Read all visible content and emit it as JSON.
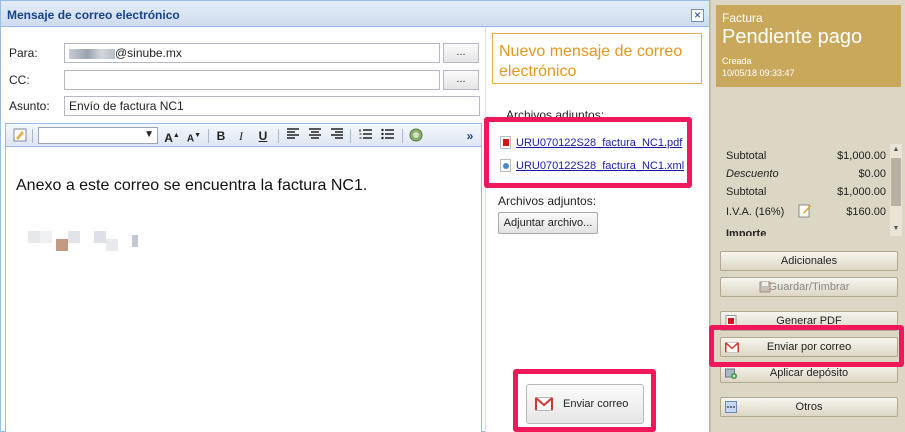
{
  "dialog": {
    "title": "Mensaje de correo electrónico",
    "close_glyph": "×"
  },
  "form": {
    "to_label": "Para:",
    "to_value": "@sinube.mx",
    "cc_label": "CC:",
    "cc_value": "",
    "subject_label": "Asunto:",
    "subject_value": "Envío de factura NC1",
    "lookup_label": "..."
  },
  "toolbar": {
    "icons": [
      "style-icon",
      "font-family-select",
      "grow-font-icon",
      "shrink-font-icon",
      "bold-icon",
      "italic-icon",
      "underline-icon",
      "align-left-icon",
      "align-center-icon",
      "align-right-icon",
      "ordered-list-icon",
      "unordered-list-icon",
      "source-edit-icon",
      "more-icon"
    ],
    "bold": "B",
    "italic": "I",
    "underline": "U",
    "more": "»"
  },
  "editor": {
    "body_text": "Anexo a este correo se encuentra la factura NC1."
  },
  "side": {
    "new_message_title": "Nuevo mensaje de correo electrónico",
    "attachments_heading": "Archivos adjuntos:",
    "attachments": [
      {
        "name": "URU070122S28_factura_NC1.pdf",
        "icon": "pdf-file-icon"
      },
      {
        "name": "URU070122S28_factura_NC1.xml",
        "icon": "xml-file-icon"
      }
    ],
    "attachments_heading_2": "Archivos adjuntos:",
    "attach_button": "Adjuntar archivo...",
    "send_button": "Enviar correo"
  },
  "invoice": {
    "type": "Factura",
    "status": "Pendiente pago",
    "created_label": "Creada",
    "created_at": "10/05/18 09:33:47",
    "status_color": "#c9a85c",
    "totals": [
      {
        "label": "Subtotal",
        "value": "$1,000.00",
        "italic": false
      },
      {
        "label": "Descuento",
        "value": "$0.00",
        "italic": true
      },
      {
        "label": "Subtotal",
        "value": "$1,000.00",
        "italic": false
      },
      {
        "label": "I.V.A. (16%)",
        "value": "$160.00",
        "italic": false
      },
      {
        "label": "Importe",
        "value": "",
        "italic": false
      }
    ],
    "buttons": {
      "additional": "Adicionales",
      "save_stamp": "Guardar/Timbrar",
      "generate_pdf": "Generar PDF",
      "send_email": "Enviar por correo",
      "apply_deposit": "Aplicar depósito",
      "others": "Otros"
    }
  },
  "highlight_color": "#f0185a"
}
